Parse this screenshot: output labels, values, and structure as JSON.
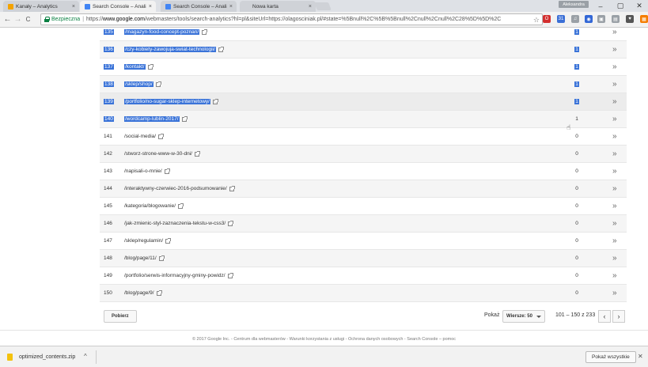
{
  "tabs": [
    {
      "title": "Kanały – Analytics",
      "color": "#f4a300",
      "active": false
    },
    {
      "title": "Search Console – Analiza",
      "color": "#4285f4",
      "active": true
    },
    {
      "title": "Search Console – Analiza",
      "color": "#4285f4",
      "active": false
    },
    {
      "title": "Nowa karta",
      "color": "",
      "active": false
    }
  ],
  "tab_close": "×",
  "profile": "Aleksandra",
  "window": {
    "minimize": "–",
    "maximize": "▢",
    "close": "✕"
  },
  "nav": {
    "back": "←",
    "forward": "→",
    "reload": "C"
  },
  "address": {
    "secure_label": "Bezpieczna",
    "url_scheme": "https://",
    "url_host": "www.google.com",
    "url_rest": "/webmasters/tools/search-analytics?hl=pl&siteUrl=https://olagosciniak.pl/#state=%5Bnull%2C%5B%5Bnull%2Cnull%2Cnull%2C28%5D%5D%2C"
  },
  "extensions": [
    {
      "name": "opera-icon",
      "glyph": "O",
      "color": "#d32f2f"
    },
    {
      "name": "calendar-icon",
      "glyph": "31",
      "color": "#3b6fd6"
    },
    {
      "name": "music-icon",
      "glyph": "♫",
      "color": "#9aa0a6"
    },
    {
      "name": "chrome-ext-icon",
      "glyph": "◉",
      "color": "#3367d6"
    },
    {
      "name": "box-icon",
      "glyph": "▣",
      "color": "#9aa0a6"
    },
    {
      "name": "bookmark-icon",
      "glyph": "▤",
      "color": "#9aa0a6"
    },
    {
      "name": "pocket-icon",
      "glyph": "♥",
      "color": "#555"
    },
    {
      "name": "ext-orange-icon",
      "glyph": "▦",
      "color": "#f57c00"
    },
    {
      "name": "menu-icon",
      "glyph": "⋮",
      "color": "#555"
    }
  ],
  "rows": [
    {
      "num": "135",
      "page": "/magazyn-food-concept-poznan/",
      "value": "1",
      "selected": true
    },
    {
      "num": "136",
      "page": "/czy-kobiety-zawojuja-swiat-technologii/",
      "value": "1",
      "selected": true
    },
    {
      "num": "137",
      "page": "/kontakt/",
      "value": "1",
      "selected": true
    },
    {
      "num": "138",
      "page": "/sklep/shop/",
      "value": "1",
      "selected": true
    },
    {
      "num": "139",
      "page": "/portfolio/no-sugar-sklep-internetowy/",
      "value": "1",
      "selected": true
    },
    {
      "num": "140",
      "page": "/wordcamp-lublin-2017/",
      "value": "1",
      "selected": true
    },
    {
      "num": "141",
      "page": "/social-media/",
      "value": "0",
      "selected": false
    },
    {
      "num": "142",
      "page": "/stworz-strone-www-w-30-dni/",
      "value": "0",
      "selected": false
    },
    {
      "num": "143",
      "page": "/napisali-o-mnie/",
      "value": "0",
      "selected": false
    },
    {
      "num": "144",
      "page": "/interaktywny-czerwiec-2016-podsumowanie/",
      "value": "0",
      "selected": false
    },
    {
      "num": "145",
      "page": "/kategoria/blogowanie/",
      "value": "0",
      "selected": false
    },
    {
      "num": "146",
      "page": "/jak-zmienic-styl-zaznaczenia-tekstu-w-css3/",
      "value": "0",
      "selected": false
    },
    {
      "num": "147",
      "page": "/sklep/regulamin/",
      "value": "0",
      "selected": false
    },
    {
      "num": "148",
      "page": "/blog/page/11/",
      "value": "0",
      "selected": false
    },
    {
      "num": "149",
      "page": "/portfolio/serwis-informacyjny-gminy-powidz/",
      "value": "0",
      "selected": false
    },
    {
      "num": "150",
      "page": "/blog/page/9/",
      "value": "0",
      "selected": false
    }
  ],
  "row_chevron": "»",
  "pager": {
    "download": "Pobierz",
    "show": "Pokaż",
    "rows_per_page": "Wiersze: 50",
    "range": "101 – 150 z 233",
    "prev": "‹",
    "next": "›"
  },
  "footer": "© 2017 Google Inc. - Centrum dla webmasterów - Warunki korzystania z usługi - Ochrona danych osobowych - Search Console – pomoc",
  "download_bar": {
    "file": "optimized_contents.zip",
    "chevron": "^",
    "show_all": "Pokaż wszystkie",
    "close": "✕"
  },
  "colors": {
    "selection": "#3a73d8",
    "secure": "#0b8043"
  }
}
